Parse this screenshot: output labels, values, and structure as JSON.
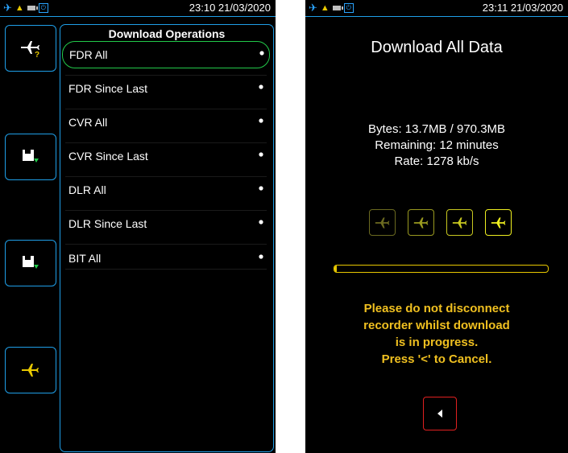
{
  "left": {
    "status": {
      "time": "23:10 21/03/2020",
      "icons": [
        "airplane-icon",
        "network-icon",
        "battery-icon",
        "plug-icon"
      ]
    },
    "side_buttons": [
      {
        "icon": "plane-help-icon",
        "color": "#ffffff",
        "accent": "#e8c800"
      },
      {
        "icon": "save-green-icon",
        "color": "#ffffff",
        "accent": "#22c94a"
      },
      {
        "icon": "save-green-icon",
        "color": "#ffffff",
        "accent": "#22c94a"
      },
      {
        "icon": "airplane-yellow-icon",
        "color": "#e8c800"
      }
    ],
    "list": {
      "title": "Download Operations",
      "items": [
        {
          "label": "FDR All",
          "selected": true
        },
        {
          "label": "FDR Since Last"
        },
        {
          "label": "CVR All"
        },
        {
          "label": "CVR Since Last"
        },
        {
          "label": "DLR All"
        },
        {
          "label": "DLR Since Last"
        },
        {
          "label": "BIT All"
        }
      ]
    }
  },
  "right": {
    "status": {
      "time": "23:11 21/03/2020"
    },
    "title": "Download All Data",
    "bytes": "Bytes: 13.7MB / 970.3MB",
    "remaining": "Remaining: 12 minutes",
    "rate": "Rate: 1278 kb/s",
    "stages": [
      {
        "icon": "airplane-icon",
        "color": "#6b6a20"
      },
      {
        "icon": "airplane-icon",
        "color": "#9a9a20"
      },
      {
        "icon": "airplane-icon",
        "color": "#c8c820"
      },
      {
        "icon": "airplane-icon",
        "color": "#f0f020"
      }
    ],
    "progress": 0.012,
    "warning_lines": [
      "Please do not disconnect",
      "recorder whilst download",
      "is in progress.",
      "Press '<' to Cancel."
    ],
    "back_icon": "left-triangle-icon"
  },
  "colors": {
    "frame": "#1f9fe8",
    "selected": "#22c94a",
    "warning": "#f0c020",
    "cancel": "#e02020"
  }
}
